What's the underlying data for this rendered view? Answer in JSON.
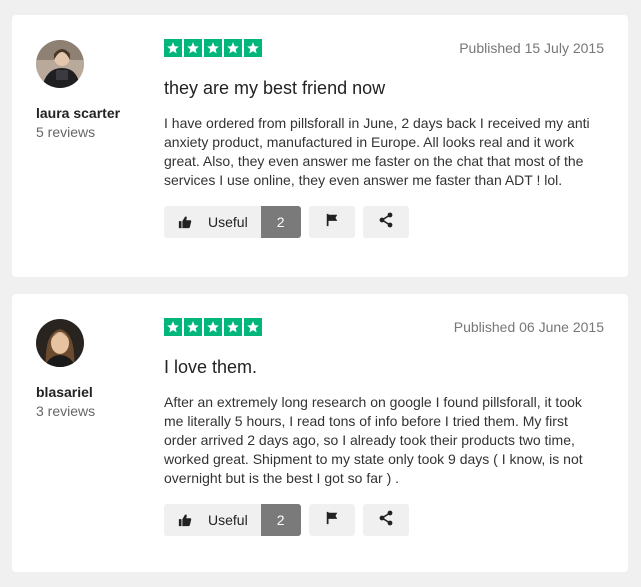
{
  "reviews": [
    {
      "reviewer_name": "laura scarter",
      "review_count": "5 reviews",
      "rating": 5,
      "published": "Published 15 July 2015",
      "title": "they are my best friend now",
      "body": "I have ordered from pillsforall in June, 2 days back I received my anti anxiety product, manufactured in Europe. All looks real and it work great. Also, they even answer me faster on the chat that most of the services I use online, they even answer me faster than ADT ! lol.",
      "useful_label": "Useful",
      "useful_count": "2"
    },
    {
      "reviewer_name": "blasariel",
      "review_count": "3 reviews",
      "rating": 5,
      "published": "Published 06 June 2015",
      "title": "I love them.",
      "body": "After an extremely long research on google I found pillsforall, it took me literally 5 hours, I read tons of info before I tried them. My first order arrived 2 days ago, so I already took their products two time, worked great. Shipment to my state only took 9 days ( I know, is not overnight but is the best I got so far ) .",
      "useful_label": "Useful",
      "useful_count": "2"
    }
  ],
  "colors": {
    "star_green": "#00b67a",
    "count_gray": "#7a7a7a",
    "button_bg": "#f0f0f0"
  },
  "icons": [
    "thumbs-up-icon",
    "flag-icon",
    "share-icon",
    "star-icon"
  ]
}
